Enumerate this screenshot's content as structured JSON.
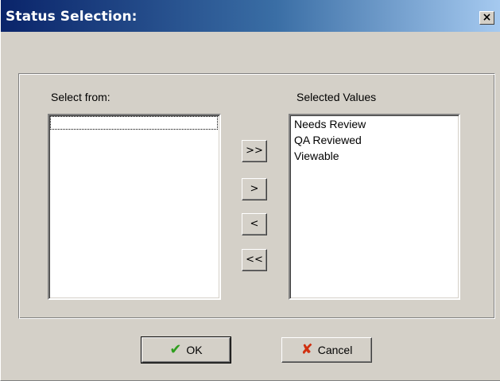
{
  "window": {
    "title": "Status Selection:",
    "close_glyph": "×"
  },
  "select_from": {
    "label": "Select from:",
    "items": []
  },
  "selected_values": {
    "label": "Selected Values",
    "items": [
      "Needs Review",
      "QA Reviewed",
      "Viewable"
    ]
  },
  "transfer_buttons": {
    "add_all": ">>",
    "add": ">",
    "remove": "<",
    "remove_all": "<<"
  },
  "footer": {
    "ok_label": "OK",
    "ok_icon": "checkmark-icon",
    "cancel_label": "Cancel",
    "cancel_icon": "x-icon"
  },
  "colors": {
    "title_bar_start": "#0a246a",
    "title_bar_end": "#a6caf0",
    "dialog_face": "#d4d0c8",
    "ok_icon": "#2e9e1e",
    "cancel_icon": "#d03010"
  }
}
